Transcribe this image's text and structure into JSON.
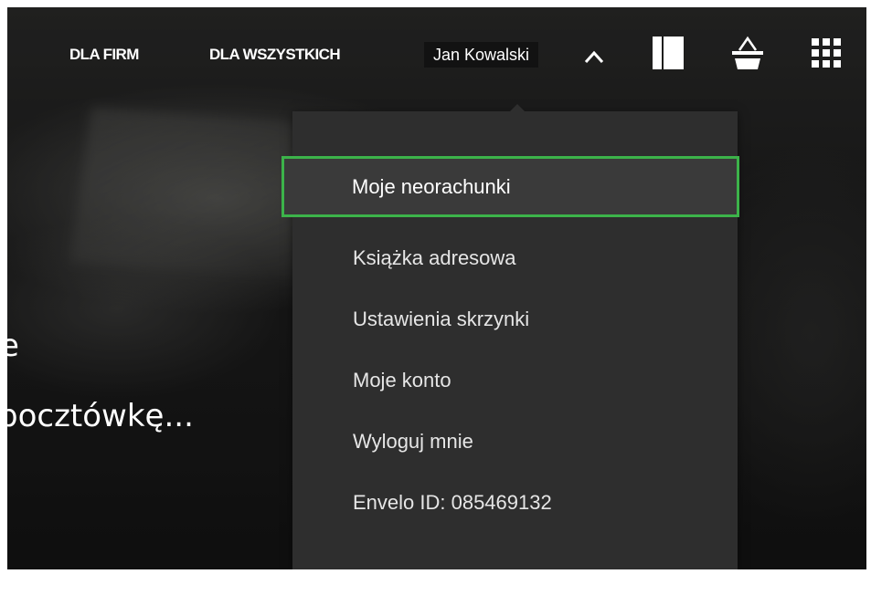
{
  "nav": {
    "for_business": "DLA FIRM",
    "for_everyone": "DLA WSZYSTKICH",
    "user_name": "Jan Kowalski"
  },
  "icons": {
    "toggle": "chevron-up-icon",
    "sidebar": "sidebar-panel-icon",
    "basket": "shopping-basket-icon",
    "apps": "apps-grid-icon"
  },
  "hero": {
    "line1": "e",
    "line2": "pocztówkę..."
  },
  "user_menu": {
    "items": [
      {
        "label": "Moje neorachunki",
        "state": "highlighted"
      },
      {
        "label": "Książka adresowa"
      },
      {
        "label": "Ustawienia skrzynki"
      },
      {
        "label": "Moje konto"
      },
      {
        "label": "Wyloguj mnie"
      },
      {
        "label": "Envelo ID: 085469132"
      }
    ]
  },
  "colors": {
    "highlight_border": "#3cb34a",
    "menu_background": "#2e2e2e",
    "text": "#ffffff"
  }
}
